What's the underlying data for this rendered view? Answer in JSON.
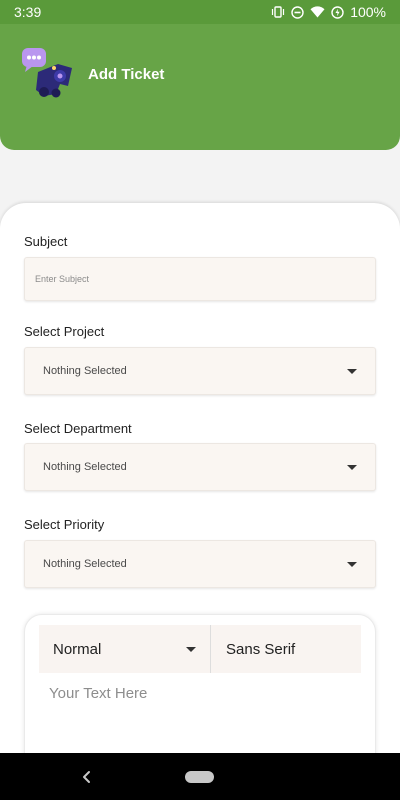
{
  "status": {
    "time": "3:39",
    "battery": "100%"
  },
  "header": {
    "title": "Add Ticket"
  },
  "form": {
    "subject_label": "Subject",
    "subject_placeholder": "Enter Subject",
    "subject_value": "",
    "project_label": "Select Project",
    "project_value": "Nothing Selected",
    "department_label": "Select Department",
    "department_value": "Nothing Selected",
    "priority_label": "Select Priority",
    "priority_value": "Nothing Selected"
  },
  "editor": {
    "format_value": "Normal",
    "font_value": "Sans Serif",
    "placeholder": "Your Text Here"
  },
  "colors": {
    "header": "#67a447",
    "status_bar": "#5a9a3a",
    "field_bg": "#faf6f2"
  },
  "icons": [
    "vibrate-icon",
    "do-not-disturb-icon",
    "wifi-icon",
    "battery-charging-icon",
    "ticket-robot-logo",
    "chevron-down-icon",
    "back-icon",
    "home-pill-icon"
  ]
}
